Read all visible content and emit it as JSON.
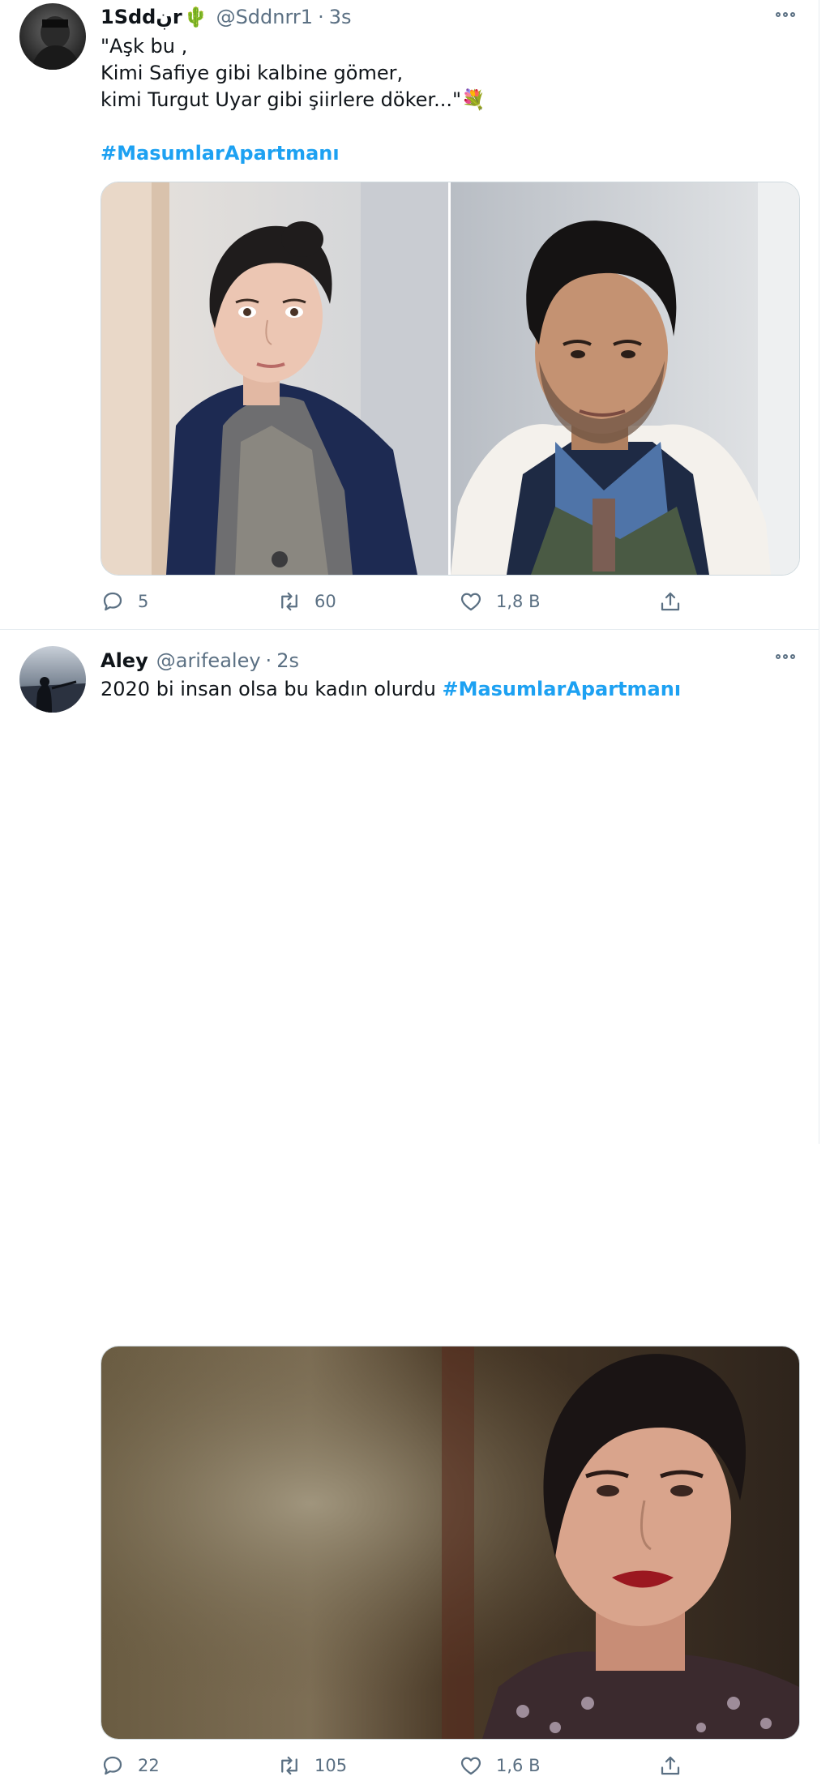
{
  "tweets": [
    {
      "display_name": "1Sddڹr",
      "name_emoji": "🌵",
      "handle": "@Sddnrr1",
      "separator": "·",
      "time": "3s",
      "text_lines": [
        "\"Aşk bu ,",
        "Kimi Safiye gibi kalbine gömer,",
        "kimi Turgut Uyar gibi şiirlere döker...\"💐"
      ],
      "hashtag": "#MasumlarApartmanı",
      "media": [
        "photo-woman-dark-hair-navy-cardigan",
        "photo-man-denim-shirt-shearling-coat"
      ],
      "replies": "5",
      "retweets": "60",
      "likes": "1,8 B",
      "icons": {
        "reply": "reply-icon",
        "retweet": "retweet-icon",
        "like": "heart-icon",
        "share": "share-icon",
        "more": "more-icon"
      }
    },
    {
      "display_name": "Aley",
      "handle": "@arifealey",
      "separator": "·",
      "time": "2s",
      "text": "2020 bi insan olsa bu kadın olurdu ",
      "hashtag": "#MasumlarApartmanı",
      "media": [
        "photo-woman-red-lipstick-floral-dress"
      ],
      "replies": "22",
      "retweets": "105",
      "likes": "1,6 B",
      "icons": {
        "reply": "reply-icon",
        "retweet": "retweet-icon",
        "like": "heart-icon",
        "share": "share-icon",
        "more": "more-icon"
      }
    }
  ],
  "colors": {
    "link": "#1da1f2",
    "secondary_text": "#5b7083",
    "border": "#cfd9de"
  }
}
